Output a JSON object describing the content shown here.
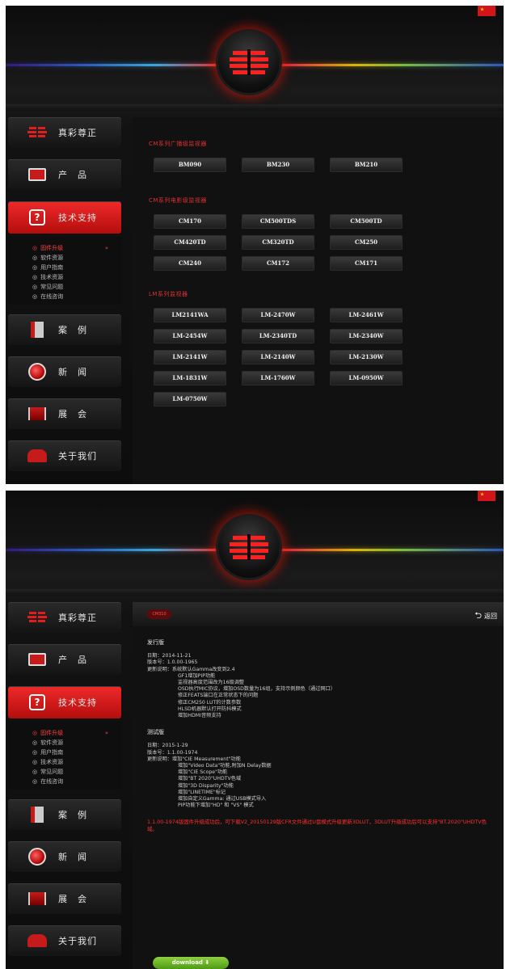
{
  "nav": {
    "items": [
      "真彩尊正",
      "产　品",
      "技术支持",
      "案　例",
      "新　闻",
      "展　会",
      "关于我们"
    ],
    "sub": [
      "固件升级",
      "软件资源",
      "用户指南",
      "技术资源",
      "常见问题",
      "在线咨询"
    ],
    "arrow": "»"
  },
  "s1": {
    "sec1": "CM系列广播级监视器",
    "sec1_items": [
      "BM090",
      "BM230",
      "BM210"
    ],
    "sec2": "CM系列电影级监视器",
    "sec2_items": [
      "CM170",
      "CM500TDS",
      "CM500TD",
      "CM420TD",
      "CM320TD",
      "CM250",
      "CM240",
      "CM172",
      "CM171"
    ],
    "sec3": "LM系列监视器",
    "sec3_items": [
      "LM2141WA",
      "LM-2470W",
      "LM-2461W",
      "LM-2454W",
      "LM-2340TD",
      "LM-2340W",
      "LM-2141W",
      "LM-2140W",
      "LM-2130W",
      "LM-1831W",
      "LM-1760W",
      "LM-0950W",
      "LM-0750W"
    ]
  },
  "s2": {
    "pill": "CM310",
    "back": "返回",
    "rel_title": "发行版",
    "rel_lines": [
      "日期：2014-11-21",
      "版本号：1.0.00-1965",
      "更新说明：系统默认Gamma改变到2.4"
    ],
    "rel_ind": [
      "GF1增加PIP功能",
      "监视器高度范围改为16级调整",
      "OSD执行MIC协议，增加OSD数量为16组，支持示例颜色（通过网口）",
      "修正FEATS端口在正常状态下的问题",
      "修正CM250 LUT的计数参数",
      "HLSD机器默认打开防抖模式",
      "增加HDMI音频支持"
    ],
    "test_title": "测试版",
    "test_lines": [
      "日期：2015-1-29",
      "版本号：1.1.00-1974",
      "更新说明：增加\"CIE Measurement\"功能"
    ],
    "test_ind": [
      "增加\"Video Data\"功能,附加N Delay数据",
      "增加\"CIE Scope\"功能",
      "增加\"BT 2020\"UHDTV色域",
      "增加\"3D Disparity\"功能",
      "增加\"LINETIME\"标记",
      "增加自定义Gamma: 通过USB模式导入",
      "PIP功能下增加\"HD\" 和 \"VS\" 模式"
    ],
    "warn": "1.1.00-1974版固件升级成功后，可下载V2_20150129版CFR文件通过U盘模式升级更新3DLUT，3DLUT升级成功后可以支持\"BT.2020\"UHDTV色域。",
    "download": "download ⬇"
  }
}
